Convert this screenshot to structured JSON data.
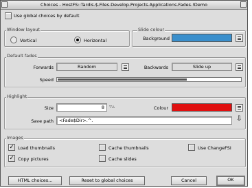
{
  "window": {
    "title": "Choices - HostFS::Tardis.$.Files.Develop.Projects.Applications.Fades.!Demo"
  },
  "global": {
    "use_global_label": "Use global choices by default",
    "use_global_checked": false
  },
  "window_layout": {
    "title": "Window layout",
    "options": [
      "Vertical",
      "Horizontal"
    ],
    "selected": "Horizontal"
  },
  "slide_colour": {
    "title": "Slide colour",
    "background_label": "Background",
    "background_color": "#3a8fcc"
  },
  "default_fades": {
    "title": "Default fades",
    "forwards_label": "Forwards",
    "forwards_value": "Random",
    "backwards_label": "Backwards",
    "backwards_value": "Slide up",
    "speed_label": "Speed",
    "speed_level": 0.7
  },
  "highlight": {
    "title": "Highlight",
    "size_label": "Size",
    "size_value": "8",
    "colour_label": "Colour",
    "colour_value": "#e01010",
    "save_path_label": "Save path",
    "save_path_value": "<Fade$Dir>.^."
  },
  "images": {
    "title": "Images",
    "load_thumbnails": {
      "label": "Load thumbnails",
      "checked": true
    },
    "copy_pictures": {
      "label": "Copy pictures",
      "checked": true
    },
    "cache_thumbnails": {
      "label": "Cache thumbnails",
      "checked": false
    },
    "cache_slides": {
      "label": "Cache slides",
      "checked": false
    },
    "use_changefsi": {
      "label": "Use ChangeFSI",
      "checked": false
    }
  },
  "buttons": {
    "html_choices": "HTML choices...",
    "reset": "Reset to global choices",
    "cancel": "Cancel",
    "ok": "OK"
  }
}
